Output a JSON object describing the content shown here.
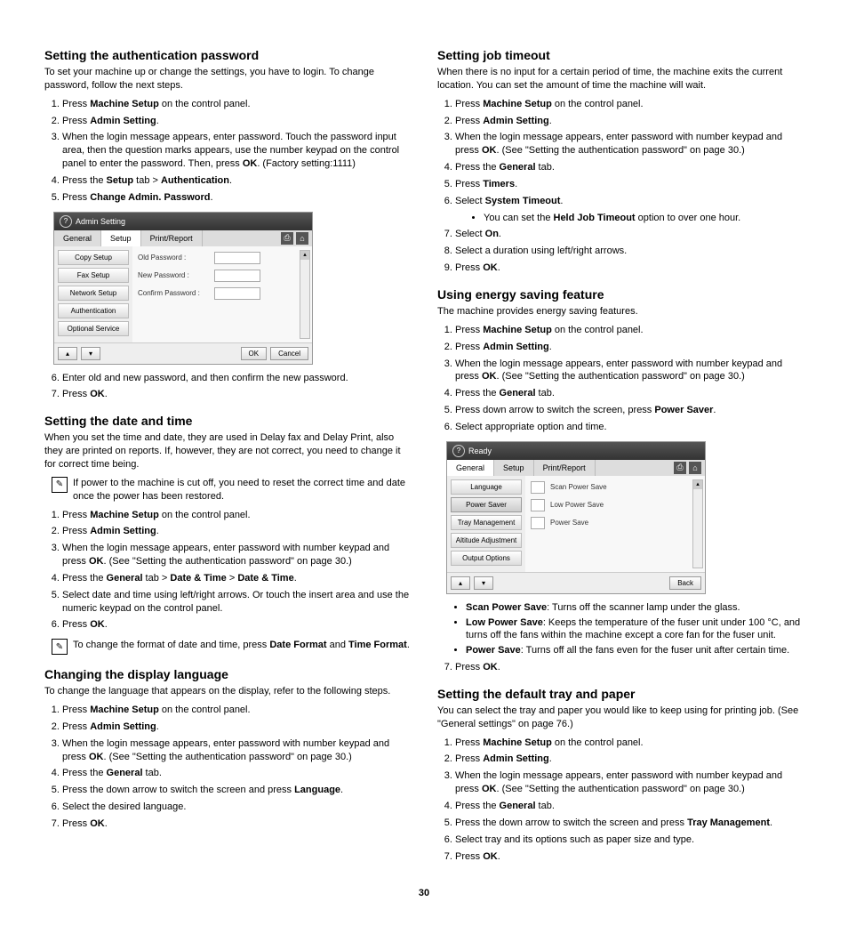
{
  "page_number": "30",
  "left": {
    "s1": {
      "heading": "Setting the authentication password",
      "intro": "To set your machine up or change the settings, you have to login. To change password, follow the next steps.",
      "steps": [
        "Press <b>Machine Setup</b> on the control panel.",
        "Press <b>Admin Setting</b>.",
        "When the login message appears, enter password. Touch the password input area, then the question marks appears, use the number keypad on the control panel to enter the password. Then, press <b>OK</b>. (Factory setting:1111)",
        "Press the <b>Setup</b> tab > <b>Authentication</b>.",
        "Press <b>Change Admin. Password</b>."
      ],
      "steps_after": [
        "Enter old and new password, and then confirm the new password.",
        "Press <b>OK</b>."
      ]
    },
    "shot1": {
      "title": "Admin Setting",
      "tabs": [
        "General",
        "Setup",
        "Print/Report"
      ],
      "active_tab": 1,
      "side": [
        "Copy Setup",
        "Fax Setup",
        "Network Setup",
        "Authentication",
        "Optional Service"
      ],
      "rows": [
        {
          "label": "Old Password :"
        },
        {
          "label": "New Password :"
        },
        {
          "label": "Confirm Password :"
        }
      ],
      "buttons": [
        "OK",
        "Cancel"
      ]
    },
    "s2": {
      "heading": "Setting the date and time",
      "intro": "When you set the time and date, they are used in Delay fax and Delay Print, also they are printed on reports. If, however, they are not correct, you need to change it for correct time being.",
      "note1": "If power to the machine is cut off, you need to reset the correct time and date once the power has been restored.",
      "steps": [
        "Press <b>Machine Setup</b> on the control panel.",
        "Press <b>Admin Setting</b>.",
        "When the login message appears, enter password with number keypad and press <b>OK</b>. (See \"Setting the authentication password\" on page 30.)",
        "Press the <b>General</b> tab > <b>Date & Time</b> > <b>Date & Time</b>.",
        "Select date and time using left/right arrows. Or touch the insert area and use the numeric keypad on the control panel.",
        "Press <b>OK</b>."
      ],
      "note2": "To change the format of date and time, press <b>Date Format</b> and <b>Time Format</b>."
    },
    "s3": {
      "heading": "Changing the display language",
      "intro": "To change the language that appears on the display, refer to the following steps.",
      "steps": [
        "Press <b>Machine Setup</b> on the control panel.",
        "Press <b>Admin Setting</b>.",
        "When the login message appears, enter password with number keypad and press <b>OK</b>. (See \"Setting the authentication password\" on page 30.)",
        "Press the <b>General</b> tab.",
        "Press the down arrow to switch the screen and press <b>Language</b>.",
        "Select the desired language.",
        "Press <b>OK</b>."
      ]
    }
  },
  "right": {
    "s4": {
      "heading": "Setting job timeout",
      "intro": "When there is no input for a certain period of time, the machine exits the current location. You can set the amount of time the machine will wait.",
      "steps": [
        "Press <b>Machine Setup</b> on the control panel.",
        "Press <b>Admin Setting</b>.",
        "When the login message appears, enter password with number keypad and press <b>OK</b>. (See \"Setting the authentication password\" on page 30.)",
        "Press the <b>General</b> tab.",
        "Press <b>Timers</b>.",
        "Select <b>System Timeout</b>.",
        "Select <b>On</b>.",
        "Select a duration using left/right arrows.",
        "Press <b>OK</b>."
      ],
      "sub_after_6": "You can set the <b>Held Job Timeout</b> option to over one hour."
    },
    "s5": {
      "heading": "Using energy saving feature",
      "intro": "The machine provides energy saving features.",
      "steps": [
        "Press <b>Machine Setup</b> on the control panel.",
        "Press <b>Admin Setting</b>.",
        "When the login message appears, enter password with number keypad and press <b>OK</b>. (See \"Setting the authentication password\" on page 30.)",
        "Press the <b>General</b> tab.",
        "Press down arrow to switch the screen, press <b>Power Saver</b>.",
        "Select appropriate option and time."
      ],
      "bullets": [
        "<b>Scan Power Save</b>: Turns off the scanner lamp under the glass.",
        "<b>Low Power Save</b>: Keeps the temperature of the fuser unit under 100 °C, and turns off the fans within the machine except a core fan for the fuser unit.",
        "<b>Power Save</b>: Turns off all the fans even for the fuser unit after certain time."
      ],
      "step7": "Press <b>OK</b>."
    },
    "shot2": {
      "title": "Ready",
      "tabs": [
        "General",
        "Setup",
        "Print/Report"
      ],
      "active_tab": 0,
      "side": [
        "Language",
        "Power Saver",
        "Tray Management",
        "Altitude Adjustment",
        "Output Options"
      ],
      "main_items": [
        "Scan Power Save",
        "Low Power Save",
        "Power Save"
      ],
      "back": "Back"
    },
    "s6": {
      "heading": "Setting the default tray and paper",
      "intro": "You can select the tray and paper you would like to keep using for printing job. (See \"General settings\" on page 76.)",
      "steps": [
        "Press <b>Machine Setup</b> on the control panel.",
        "Press <b>Admin Setting</b>.",
        "When the login message appears, enter password with number keypad and press <b>OK</b>. (See \"Setting the authentication password\" on page 30.)",
        "Press the <b>General</b> tab.",
        "Press the down arrow to switch the screen and press <b>Tray Management</b>.",
        "Select tray and its options such as paper size and type.",
        "Press <b>OK</b>."
      ]
    }
  }
}
